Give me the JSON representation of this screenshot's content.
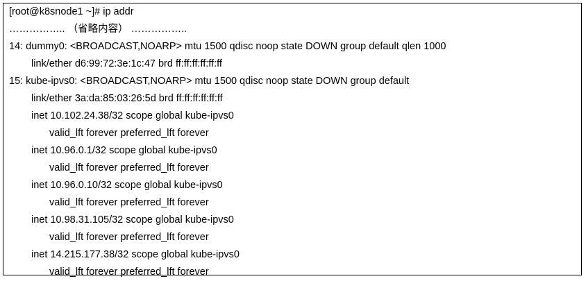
{
  "terminal": {
    "prompt": "[root@k8snode1 ~]# ip addr",
    "omitted": "…………….. （省略内容） ……………..",
    "lines": [
      {
        "text": "14: dummy0: <BROADCAST,NOARP> mtu 1500 qdisc noop state DOWN group default qlen 1000",
        "indent": 0
      },
      {
        "text": "link/ether d6:99:72:3e:1c:47 brd ff:ff:ff:ff:ff:ff",
        "indent": 1
      },
      {
        "text": "15: kube-ipvs0: <BROADCAST,NOARP> mtu 1500 qdisc noop state DOWN group default",
        "indent": 0
      },
      {
        "text": "link/ether 3a:da:85:03:26:5d brd ff:ff:ff:ff:ff:ff",
        "indent": 1
      },
      {
        "text": "inet 10.102.24.38/32 scope global kube-ipvs0",
        "indent": 1
      },
      {
        "text": "valid_lft forever preferred_lft forever",
        "indent": 2
      },
      {
        "text": "inet 10.96.0.1/32 scope global kube-ipvs0",
        "indent": 1
      },
      {
        "text": "valid_lft forever preferred_lft forever",
        "indent": 2
      },
      {
        "text": "inet 10.96.0.10/32 scope global kube-ipvs0",
        "indent": 1
      },
      {
        "text": "valid_lft forever preferred_lft forever",
        "indent": 2
      },
      {
        "text": "inet 10.98.31.105/32 scope global kube-ipvs0",
        "indent": 1
      },
      {
        "text": "valid_lft forever preferred_lft forever",
        "indent": 2
      },
      {
        "text": "inet 14.215.177.38/32 scope global kube-ipvs0",
        "indent": 1
      },
      {
        "text": "valid_lft forever preferred_lft forever",
        "indent": 2
      }
    ]
  }
}
